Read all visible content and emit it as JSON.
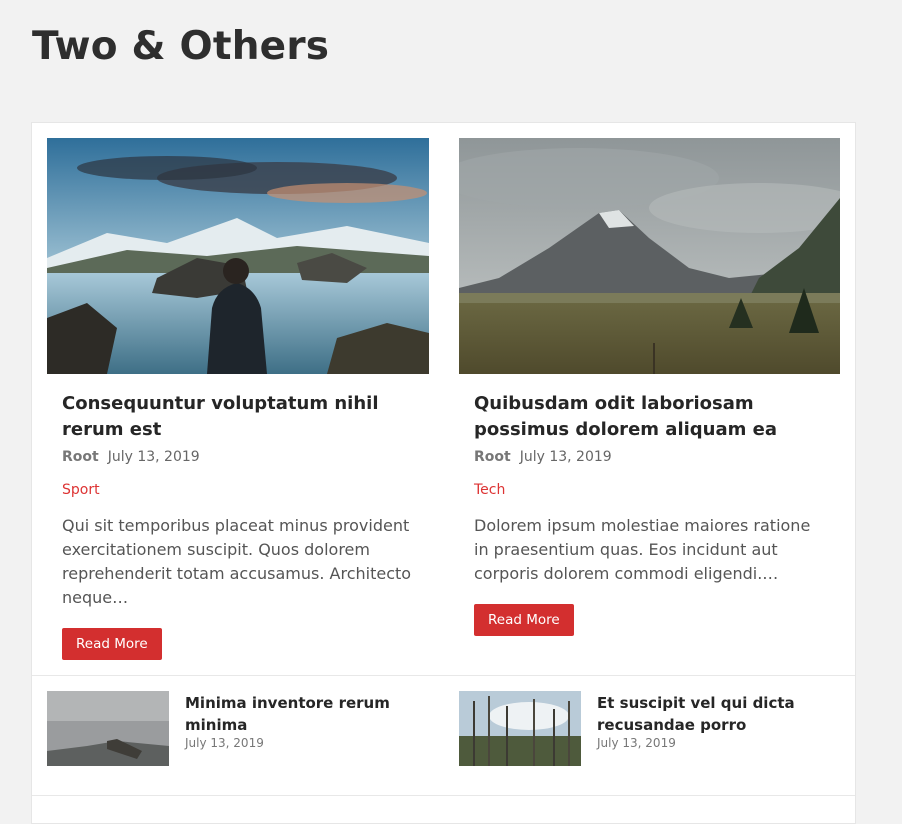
{
  "page": {
    "title": "Two & Others"
  },
  "featured_posts": [
    {
      "title": "Consequuntur voluptatum nihil rerum est",
      "author": "Root",
      "date": "July 13, 2019",
      "category": "Sport",
      "excerpt": "Qui sit temporibus placeat minus provident exercitationem suscipit. Quos dolorem reprehenderit totam accusamus. Architecto neque…",
      "button": "Read More",
      "image": "man-by-mountain-lake"
    },
    {
      "title": "Quibusdam odit laboriosam possimus dolorem aliquam ea",
      "author": "Root",
      "date": "July 13, 2019",
      "category": "Tech",
      "excerpt": "Dolorem ipsum molestiae maiores ratione in praesentium quas. Eos incidunt aut corporis dolorem commodi eligendi.…",
      "button": "Read More",
      "image": "mountain-valley-cloudy"
    }
  ],
  "other_posts": [
    {
      "title": "Minima inventore rerum minima",
      "date": "July 13, 2019",
      "image": "foggy-pier"
    },
    {
      "title": "Et suscipit vel qui dicta recusandae porro",
      "date": "July 13, 2019",
      "image": "bare-trees-sky"
    }
  ],
  "colors": {
    "accent": "#d32f2f",
    "background": "#f2f2f2",
    "card": "#ffffff"
  }
}
